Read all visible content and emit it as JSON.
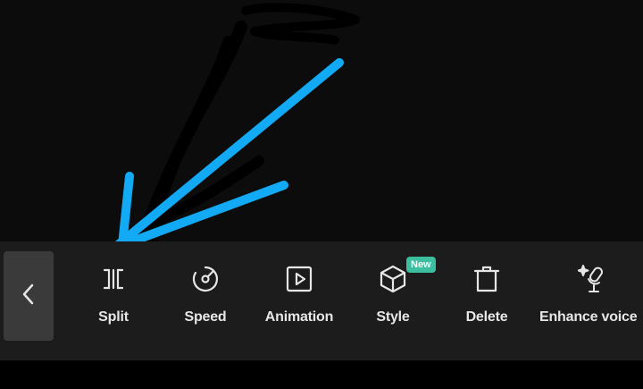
{
  "toolbar": {
    "back_icon": "chevron-left-icon",
    "tools": [
      {
        "id": "split",
        "label": "Split",
        "icon": "split-icon"
      },
      {
        "id": "speed",
        "label": "Speed",
        "icon": "speed-icon"
      },
      {
        "id": "animation",
        "label": "Animation",
        "icon": "animation-icon"
      },
      {
        "id": "style",
        "label": "Style",
        "icon": "cube-icon",
        "badge": "New"
      },
      {
        "id": "delete",
        "label": "Delete",
        "icon": "trash-icon"
      },
      {
        "id": "enhance_voice",
        "label": "Enhance voice",
        "icon": "magic-mic-icon"
      }
    ]
  },
  "colors": {
    "annotation_arrow": "#12aaf5",
    "badge": "#3bbfa0",
    "toolbar_bg": "#1c1c1c",
    "preview_bg": "#0c0c0c"
  }
}
